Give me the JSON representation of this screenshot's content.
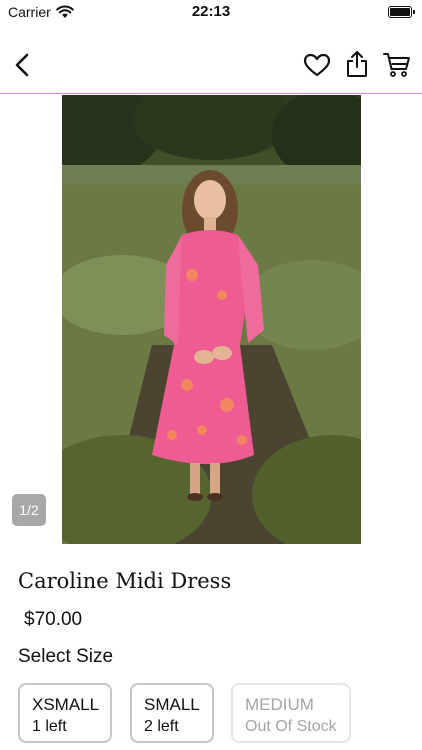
{
  "status_bar": {
    "carrier": "Carrier",
    "time": "22:13"
  },
  "nav": {
    "back_icon": "chevron-left-icon",
    "favorite_icon": "heart-icon",
    "share_icon": "share-icon",
    "cart_icon": "cart-icon",
    "divider_color": "#d98bd0"
  },
  "product": {
    "image_page": "1/2",
    "title": "Caroline Midi Dress",
    "price": "$70.00",
    "size_heading": "Select Size",
    "sizes": [
      {
        "name": "XSMALL",
        "stock": "1 left",
        "available": true
      },
      {
        "name": "SMALL",
        "stock": "2 left",
        "available": true
      },
      {
        "name": "MEDIUM",
        "stock": "Out Of Stock",
        "available": false
      }
    ]
  }
}
